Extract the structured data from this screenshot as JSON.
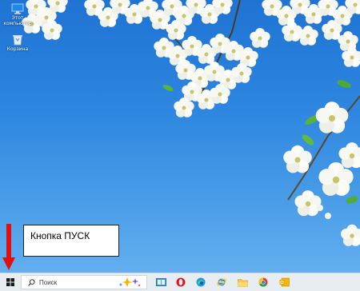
{
  "desktop": {
    "icons": [
      {
        "label_line1": "Этот",
        "label_line2": "компьютер",
        "icon": "this-pc-icon"
      },
      {
        "label_line1": "Корзина",
        "label_line2": "",
        "icon": "recycle-bin-icon"
      }
    ]
  },
  "annotation": {
    "text": "Кнопка ПУСК",
    "arrow_color": "#e01010"
  },
  "taskbar": {
    "start_icon": "windows-logo-icon",
    "search_placeholder": "Поиск",
    "pinned": [
      {
        "name": "copilot-icon"
      },
      {
        "name": "task-view-icon"
      },
      {
        "name": "opera-icon"
      },
      {
        "name": "edge-icon"
      },
      {
        "name": "internet-explorer-icon"
      },
      {
        "name": "file-explorer-icon"
      },
      {
        "name": "chrome-icon"
      },
      {
        "name": "outlook-icon"
      }
    ]
  },
  "colors": {
    "accent": "#1f73d3",
    "taskbar": "#e8edf2"
  }
}
